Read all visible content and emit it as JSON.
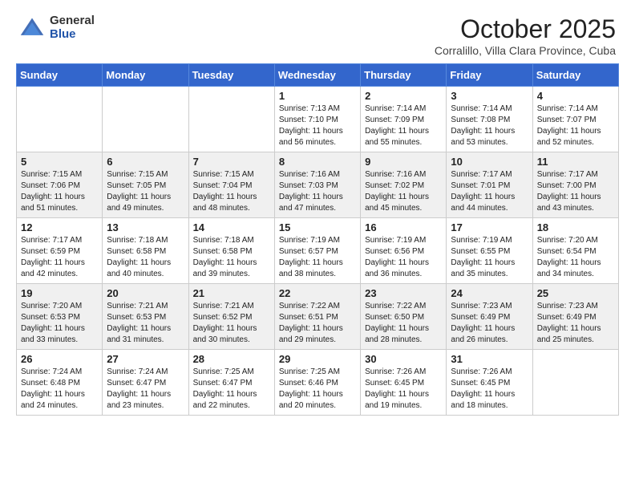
{
  "header": {
    "logo_general": "General",
    "logo_blue": "Blue",
    "month_title": "October 2025",
    "location": "Corralillo, Villa Clara Province, Cuba"
  },
  "days_of_week": [
    "Sunday",
    "Monday",
    "Tuesday",
    "Wednesday",
    "Thursday",
    "Friday",
    "Saturday"
  ],
  "weeks": [
    [
      {
        "num": "",
        "info": ""
      },
      {
        "num": "",
        "info": ""
      },
      {
        "num": "",
        "info": ""
      },
      {
        "num": "1",
        "info": "Sunrise: 7:13 AM\nSunset: 7:10 PM\nDaylight: 11 hours and 56 minutes."
      },
      {
        "num": "2",
        "info": "Sunrise: 7:14 AM\nSunset: 7:09 PM\nDaylight: 11 hours and 55 minutes."
      },
      {
        "num": "3",
        "info": "Sunrise: 7:14 AM\nSunset: 7:08 PM\nDaylight: 11 hours and 53 minutes."
      },
      {
        "num": "4",
        "info": "Sunrise: 7:14 AM\nSunset: 7:07 PM\nDaylight: 11 hours and 52 minutes."
      }
    ],
    [
      {
        "num": "5",
        "info": "Sunrise: 7:15 AM\nSunset: 7:06 PM\nDaylight: 11 hours and 51 minutes."
      },
      {
        "num": "6",
        "info": "Sunrise: 7:15 AM\nSunset: 7:05 PM\nDaylight: 11 hours and 49 minutes."
      },
      {
        "num": "7",
        "info": "Sunrise: 7:15 AM\nSunset: 7:04 PM\nDaylight: 11 hours and 48 minutes."
      },
      {
        "num": "8",
        "info": "Sunrise: 7:16 AM\nSunset: 7:03 PM\nDaylight: 11 hours and 47 minutes."
      },
      {
        "num": "9",
        "info": "Sunrise: 7:16 AM\nSunset: 7:02 PM\nDaylight: 11 hours and 45 minutes."
      },
      {
        "num": "10",
        "info": "Sunrise: 7:17 AM\nSunset: 7:01 PM\nDaylight: 11 hours and 44 minutes."
      },
      {
        "num": "11",
        "info": "Sunrise: 7:17 AM\nSunset: 7:00 PM\nDaylight: 11 hours and 43 minutes."
      }
    ],
    [
      {
        "num": "12",
        "info": "Sunrise: 7:17 AM\nSunset: 6:59 PM\nDaylight: 11 hours and 42 minutes."
      },
      {
        "num": "13",
        "info": "Sunrise: 7:18 AM\nSunset: 6:58 PM\nDaylight: 11 hours and 40 minutes."
      },
      {
        "num": "14",
        "info": "Sunrise: 7:18 AM\nSunset: 6:58 PM\nDaylight: 11 hours and 39 minutes."
      },
      {
        "num": "15",
        "info": "Sunrise: 7:19 AM\nSunset: 6:57 PM\nDaylight: 11 hours and 38 minutes."
      },
      {
        "num": "16",
        "info": "Sunrise: 7:19 AM\nSunset: 6:56 PM\nDaylight: 11 hours and 36 minutes."
      },
      {
        "num": "17",
        "info": "Sunrise: 7:19 AM\nSunset: 6:55 PM\nDaylight: 11 hours and 35 minutes."
      },
      {
        "num": "18",
        "info": "Sunrise: 7:20 AM\nSunset: 6:54 PM\nDaylight: 11 hours and 34 minutes."
      }
    ],
    [
      {
        "num": "19",
        "info": "Sunrise: 7:20 AM\nSunset: 6:53 PM\nDaylight: 11 hours and 33 minutes."
      },
      {
        "num": "20",
        "info": "Sunrise: 7:21 AM\nSunset: 6:53 PM\nDaylight: 11 hours and 31 minutes."
      },
      {
        "num": "21",
        "info": "Sunrise: 7:21 AM\nSunset: 6:52 PM\nDaylight: 11 hours and 30 minutes."
      },
      {
        "num": "22",
        "info": "Sunrise: 7:22 AM\nSunset: 6:51 PM\nDaylight: 11 hours and 29 minutes."
      },
      {
        "num": "23",
        "info": "Sunrise: 7:22 AM\nSunset: 6:50 PM\nDaylight: 11 hours and 28 minutes."
      },
      {
        "num": "24",
        "info": "Sunrise: 7:23 AM\nSunset: 6:49 PM\nDaylight: 11 hours and 26 minutes."
      },
      {
        "num": "25",
        "info": "Sunrise: 7:23 AM\nSunset: 6:49 PM\nDaylight: 11 hours and 25 minutes."
      }
    ],
    [
      {
        "num": "26",
        "info": "Sunrise: 7:24 AM\nSunset: 6:48 PM\nDaylight: 11 hours and 24 minutes."
      },
      {
        "num": "27",
        "info": "Sunrise: 7:24 AM\nSunset: 6:47 PM\nDaylight: 11 hours and 23 minutes."
      },
      {
        "num": "28",
        "info": "Sunrise: 7:25 AM\nSunset: 6:47 PM\nDaylight: 11 hours and 22 minutes."
      },
      {
        "num": "29",
        "info": "Sunrise: 7:25 AM\nSunset: 6:46 PM\nDaylight: 11 hours and 20 minutes."
      },
      {
        "num": "30",
        "info": "Sunrise: 7:26 AM\nSunset: 6:45 PM\nDaylight: 11 hours and 19 minutes."
      },
      {
        "num": "31",
        "info": "Sunrise: 7:26 AM\nSunset: 6:45 PM\nDaylight: 11 hours and 18 minutes."
      },
      {
        "num": "",
        "info": ""
      }
    ]
  ]
}
